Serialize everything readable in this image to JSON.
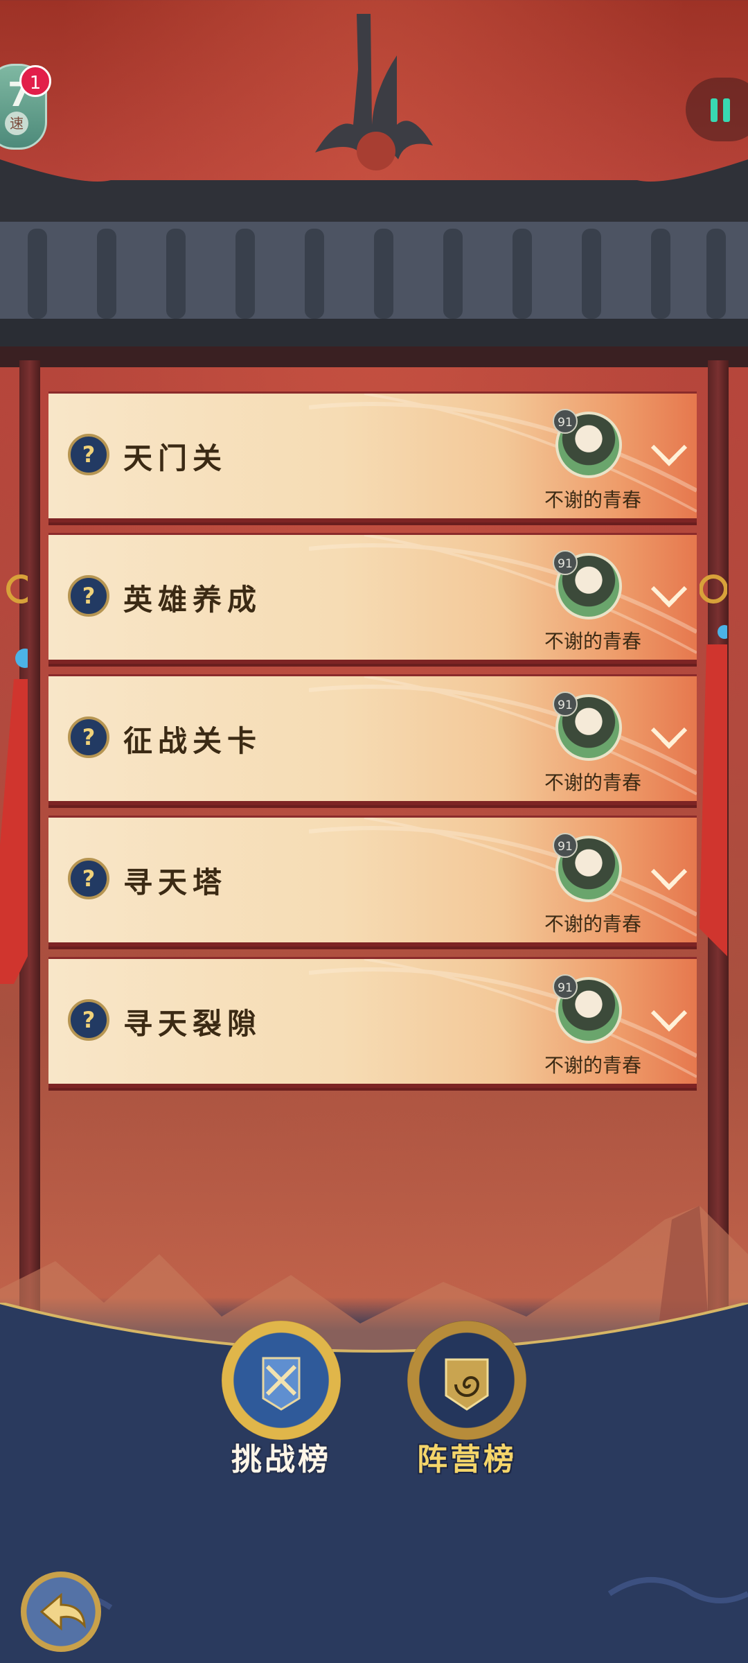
{
  "top_left": {
    "badge_char": "速",
    "notification_count": "1"
  },
  "quests": [
    {
      "title": "天门关",
      "player_level": "91",
      "player_name": "不谢的青春"
    },
    {
      "title": "英雄养成",
      "player_level": "91",
      "player_name": "不谢的青春"
    },
    {
      "title": "征战关卡",
      "player_level": "91",
      "player_name": "不谢的青春"
    },
    {
      "title": "寻天塔",
      "player_level": "91",
      "player_name": "不谢的青春"
    },
    {
      "title": "寻天裂隙",
      "player_level": "91",
      "player_name": "不谢的青春"
    }
  ],
  "quest_icon_glyph": "?",
  "bottom_nav": {
    "challenge_label": "挑战榜",
    "camp_label": "阵营榜"
  },
  "colors": {
    "accent_gold": "#e0b64a",
    "pause_accent": "#39d8b2",
    "badge_red": "#e21f4a"
  }
}
